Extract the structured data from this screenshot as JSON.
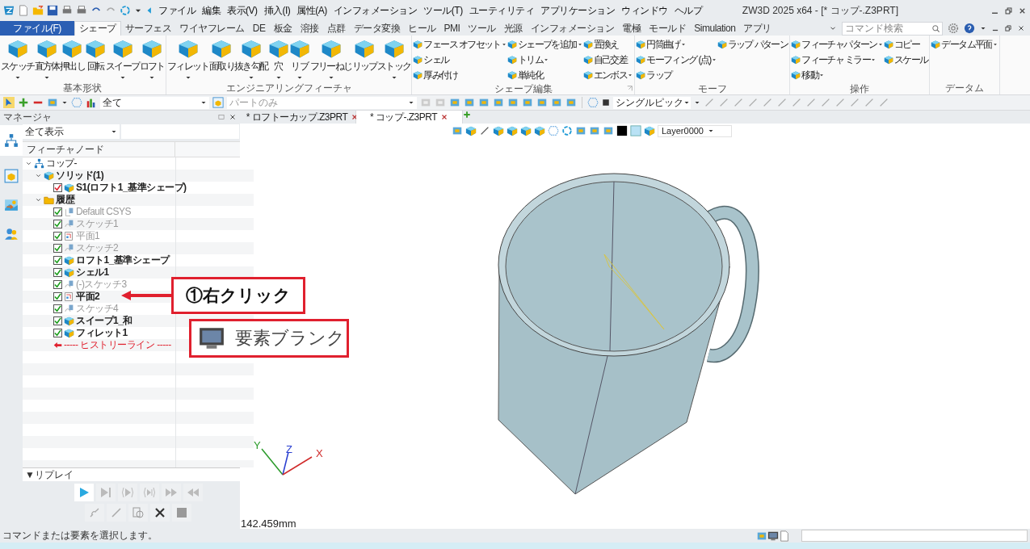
{
  "window": {
    "title": "ZW3D 2025 x64 - [* コップ-.Z3PRT]"
  },
  "menu": [
    "ファイル",
    "編集",
    "表示(V)",
    "挿入(I)",
    "属性(A)",
    "インフォメーション",
    "ツール(T)",
    "ユーティリティ",
    "アプリケーション",
    "ウィンドウ",
    "ヘルプ"
  ],
  "ribbon_tabs": [
    {
      "label": "ファイル(F)",
      "kind": "file",
      "selected": false
    },
    {
      "label": "シェープ",
      "kind": "tab",
      "selected": true
    },
    {
      "label": "サーフェス",
      "kind": "tab",
      "selected": false
    },
    {
      "label": "ワイヤフレーム",
      "kind": "tab",
      "selected": false
    },
    {
      "label": "DE",
      "kind": "tab",
      "selected": false
    },
    {
      "label": "板金",
      "kind": "tab",
      "selected": false
    },
    {
      "label": "溶接",
      "kind": "tab",
      "selected": false
    },
    {
      "label": "点群",
      "kind": "tab",
      "selected": false
    },
    {
      "label": "データ変換",
      "kind": "tab",
      "selected": false
    },
    {
      "label": "ヒール",
      "kind": "tab",
      "selected": false
    },
    {
      "label": "PMI",
      "kind": "tab",
      "selected": false
    },
    {
      "label": "ツール",
      "kind": "tab",
      "selected": false
    },
    {
      "label": "光源",
      "kind": "tab",
      "selected": false
    },
    {
      "label": "インフォメーション",
      "kind": "tab",
      "selected": false
    },
    {
      "label": "電極",
      "kind": "tab",
      "selected": false
    },
    {
      "label": "モールド",
      "kind": "tab",
      "selected": false
    },
    {
      "label": "Simulation",
      "kind": "tab",
      "selected": false
    },
    {
      "label": "アプリ",
      "kind": "tab",
      "selected": false
    }
  ],
  "command_search": {
    "placeholder": "コマンド検索"
  },
  "ribbon_groups": [
    {
      "label": "基本形状",
      "large": [
        {
          "label": "スケッチ",
          "dropdown": true
        },
        {
          "label": "直方体",
          "dropdown": true
        },
        {
          "label": "押出し",
          "dropdown": false
        },
        {
          "label": "回転",
          "dropdown": false
        },
        {
          "label": "スイープ",
          "dropdown": true
        },
        {
          "label": "ロフト",
          "dropdown": true
        }
      ]
    },
    {
      "label": "エンジニアリングフィーチャ",
      "large": [
        {
          "label": "フィレット",
          "dropdown": true
        },
        {
          "label": "面取り",
          "dropdown": false
        },
        {
          "label": "抜き勾配",
          "dropdown": true
        },
        {
          "label": "穴",
          "dropdown": true
        },
        {
          "label": "リブ",
          "dropdown": true
        },
        {
          "label": "フリーねじ",
          "dropdown": true
        },
        {
          "label": "リップ",
          "dropdown": false
        },
        {
          "label": "ストック",
          "dropdown": true
        }
      ]
    },
    {
      "label": "シェープ編集",
      "launcher": true,
      "columns": [
        [
          {
            "label": "フェース オフセット",
            "dropdown": true
          },
          {
            "label": "シェル",
            "dropdown": false
          },
          {
            "label": "厚み付け",
            "dropdown": false
          }
        ],
        [
          {
            "label": "シェープを追加",
            "dropdown": true
          },
          {
            "label": "トリム",
            "dropdown": true
          },
          {
            "label": "単純化",
            "dropdown": false
          }
        ],
        [
          {
            "label": "置換え",
            "dropdown": false
          },
          {
            "label": "自己交差",
            "dropdown": false
          },
          {
            "label": "エンボス",
            "dropdown": true
          }
        ]
      ]
    },
    {
      "label": "モーフ",
      "columns": [
        [
          {
            "label": "円筒曲げ",
            "dropdown": true
          },
          {
            "label": "モーフィング (点)",
            "dropdown": true
          },
          {
            "label": "ラップ",
            "dropdown": false
          }
        ],
        [
          {
            "label": "ラップ パターン",
            "dropdown": false
          }
        ]
      ]
    },
    {
      "label": "操作",
      "columns": [
        [
          {
            "label": "フィーチャパターン",
            "dropdown": true
          },
          {
            "label": "フィーチャ ミラー",
            "dropdown": true
          },
          {
            "label": "移動",
            "dropdown": true
          }
        ],
        [
          {
            "label": "コピー",
            "dropdown": false
          },
          {
            "label": "スケール",
            "dropdown": false
          }
        ]
      ]
    },
    {
      "label": "データム",
      "columns": [
        [
          {
            "label": "データム平面",
            "dropdown": true
          }
        ]
      ]
    }
  ],
  "toolbar": {
    "dropdowns": [
      {
        "value": "全て",
        "disabled": false
      },
      {
        "value": "パートのみ",
        "disabled": true
      },
      {
        "value": "シングルピック",
        "disabled": false
      }
    ]
  },
  "manager": {
    "title": "マネージャ",
    "side_tabs": [
      {
        "kind": "tree",
        "selected": true
      },
      {
        "kind": "part",
        "selected": false
      },
      {
        "kind": "image",
        "selected": false
      },
      {
        "kind": "user",
        "selected": false
      }
    ],
    "view_filter": "全て表示",
    "column": "フィーチャノード",
    "tree": [
      {
        "label": "コップ-",
        "kind": "root",
        "expanded": true,
        "children": [
          {
            "label": "ソリッド(1)",
            "kind": "solid_folder",
            "expanded": true,
            "children": [
              {
                "label": "S1(ロフト1_基準シェープ)",
                "kind": "body",
                "checked": true,
                "dimmed": false
              }
            ]
          },
          {
            "label": "履歴",
            "kind": "history_folder",
            "expanded": true,
            "children": [
              {
                "label": "Default CSYS",
                "kind": "csys",
                "checked": true,
                "dimmed": true
              },
              {
                "label": "スケッチ1",
                "kind": "sketch",
                "checked": true,
                "dimmed": true
              },
              {
                "label": "平面1",
                "kind": "plane",
                "checked": true,
                "dimmed": true
              },
              {
                "label": "スケッチ2",
                "kind": "sketch",
                "checked": true,
                "dimmed": true
              },
              {
                "label": "ロフト1_基準シェープ",
                "kind": "loft",
                "checked": true,
                "dimmed": false
              },
              {
                "label": "シェル1",
                "kind": "shell",
                "checked": true,
                "dimmed": false
              },
              {
                "label": "(-)スケッチ3",
                "kind": "sketch",
                "checked": true,
                "dimmed": true
              },
              {
                "label": "平面2",
                "kind": "plane",
                "checked": true,
                "dimmed": false
              },
              {
                "label": "スケッチ4",
                "kind": "sketch",
                "checked": true,
                "dimmed": true
              },
              {
                "label": "スイープ1_和",
                "kind": "sweep",
                "checked": true,
                "dimmed": false
              },
              {
                "label": "フィレット1",
                "kind": "fillet",
                "checked": true,
                "dimmed": false
              },
              {
                "label": "----- ヒストリーライン -----",
                "kind": "history_line"
              }
            ]
          }
        ]
      }
    ],
    "replay": {
      "label": "▼リプレイ",
      "controls": [
        {
          "kind": "play",
          "enabled": true
        },
        {
          "kind": "step_end",
          "enabled": false
        },
        {
          "kind": "step",
          "enabled": false
        },
        {
          "kind": "step_into",
          "enabled": false
        },
        {
          "kind": "fast_forward",
          "enabled": false
        },
        {
          "kind": "rewind",
          "enabled": false
        },
        {
          "kind": "link",
          "enabled": false
        },
        {
          "kind": "pencil",
          "enabled": false
        },
        {
          "kind": "reorder",
          "enabled": false
        },
        {
          "kind": "delete",
          "enabled": true
        },
        {
          "kind": "square",
          "enabled": false
        }
      ]
    }
  },
  "documents": [
    {
      "label": "* ロフトーカップ.Z3PRT",
      "selected": false
    },
    {
      "label": "* コップ-.Z3PRT",
      "selected": true
    }
  ],
  "viewport": {
    "layer": "Layer0000",
    "axes": [
      "X",
      "Y",
      "Z"
    ],
    "measurement": "142.459mm"
  },
  "annotations": {
    "step": "①右クリック",
    "menu_item": "要素ブランク"
  },
  "status_bar": {
    "message": "コマンドまたは要素を選択します。"
  }
}
